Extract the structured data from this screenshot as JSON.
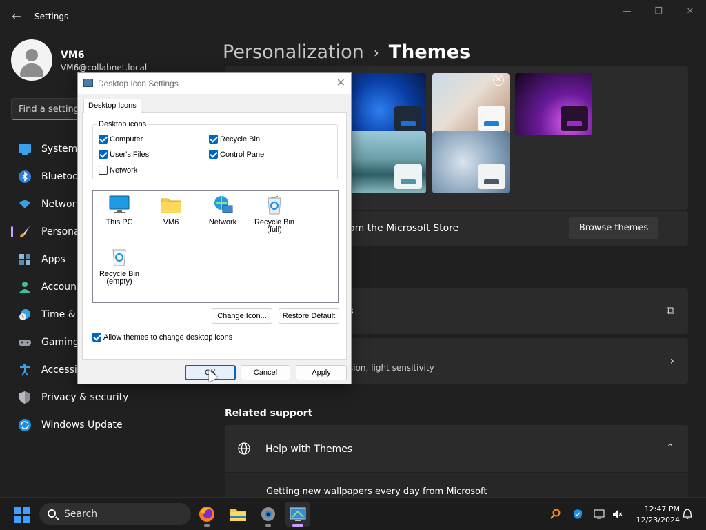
{
  "window": {
    "title": "Settings"
  },
  "profile": {
    "name": "VM6",
    "email": "VM6@collabnet.local"
  },
  "search": {
    "placeholder": "Find a setting"
  },
  "nav": [
    {
      "label": "System",
      "icon": "monitor-icon"
    },
    {
      "label": "Bluetoot",
      "icon": "bluetooth-icon"
    },
    {
      "label": "Network",
      "icon": "wifi-icon"
    },
    {
      "label": "Personal",
      "icon": "brush-icon",
      "selected": true
    },
    {
      "label": "Apps",
      "icon": "apps-icon"
    },
    {
      "label": "Account",
      "icon": "person-icon"
    },
    {
      "label": "Time & l",
      "icon": "clock-globe-icon"
    },
    {
      "label": "Gaming",
      "icon": "controller-icon"
    },
    {
      "label": "Accessib",
      "icon": "accessibility-icon"
    },
    {
      "label": "Privacy & security",
      "icon": "shield-icon"
    },
    {
      "label": "Windows Update",
      "icon": "update-icon"
    }
  ],
  "breadcrumb": {
    "parent": "Personalization",
    "separator": "›",
    "current": "Themes"
  },
  "main": {
    "store_text": "om the Microsoft Store",
    "browse_button": "Browse themes",
    "row1_text": "s",
    "row2_sub": "sion, light sensitivity",
    "related_title": "Related support",
    "help_title": "Help with Themes",
    "help_link": "Getting new wallpapers every day from Microsoft"
  },
  "dialog": {
    "title": "Desktop Icon Settings",
    "tab": "Desktop Icons",
    "group_label": "Desktop icons",
    "checkboxes": [
      {
        "label": "Computer",
        "checked": true
      },
      {
        "label": "Recycle Bin",
        "checked": true
      },
      {
        "label": "User's Files",
        "checked": true
      },
      {
        "label": "Control Panel",
        "checked": true
      },
      {
        "label": "Network",
        "checked": false
      }
    ],
    "icons": [
      {
        "label": "This PC",
        "icon": "pc-icon"
      },
      {
        "label": "VM6",
        "icon": "folder-icon"
      },
      {
        "label": "Network",
        "icon": "network-icon"
      },
      {
        "label": "Recycle Bin\n(full)",
        "icon": "recycle-bin-full-icon"
      },
      {
        "label": "Recycle Bin\n(empty)",
        "icon": "recycle-bin-empty-icon"
      }
    ],
    "change_icon": "Change Icon...",
    "restore_default": "Restore Default",
    "allow_themes": "Allow themes to change desktop icons",
    "allow_themes_checked": true,
    "ok": "OK",
    "cancel": "Cancel",
    "apply": "Apply"
  },
  "taskbar": {
    "search": "Search",
    "time": "12:47 PM",
    "date": "12/23/2024"
  },
  "colors": {
    "accent": "#c8a0ff",
    "primary_button": "#0067c0",
    "background": "#202020",
    "card": "#2b2b2b"
  }
}
